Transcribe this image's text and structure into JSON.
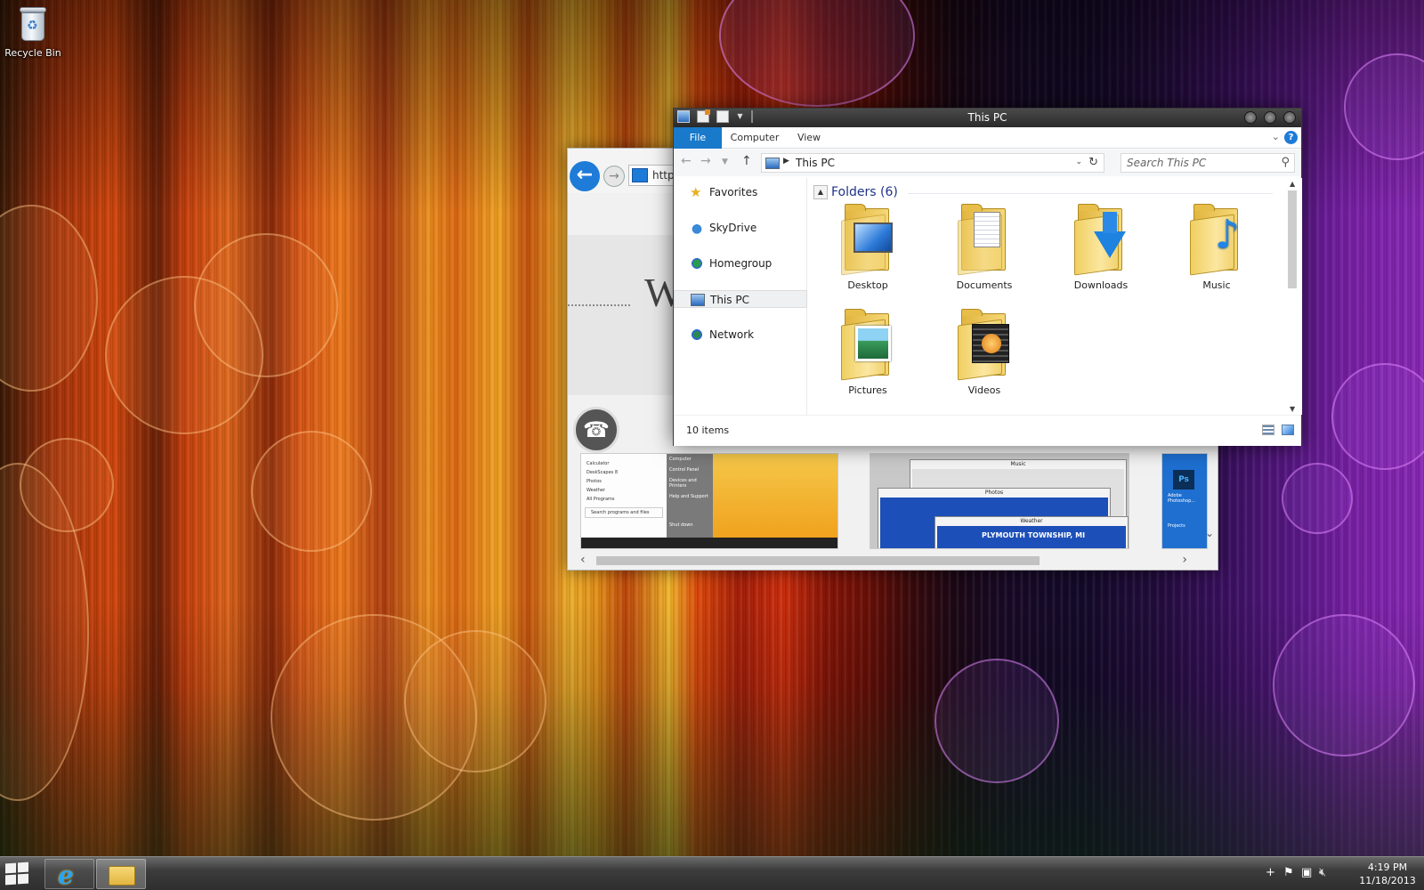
{
  "desktop": {
    "icons": [
      {
        "label": "Recycle Bin",
        "icon": "recycle-bin-icon"
      }
    ]
  },
  "browser": {
    "address": "http:/",
    "heading_char": "W",
    "thumbnails": {
      "start_menu": [
        "Calculator",
        "DeskScapes 8",
        "Photos",
        "Weather",
        "All Programs"
      ],
      "start_side": [
        "Computer",
        "Control Panel",
        "Devices and Printers",
        "Help and Support"
      ],
      "search_placeholder": "Search programs and files",
      "shutdown": "Shut down",
      "windows": [
        "Music",
        "Photos",
        "Weather"
      ],
      "banner": "PLYMOUTH TOWNSHIP, MI",
      "app_tiles": [
        "Adobe Photoshop...",
        "Projects"
      ],
      "ps_glyph": "Ps"
    }
  },
  "explorer": {
    "title": "This PC",
    "ribbon_tabs": [
      "File",
      "Computer",
      "View"
    ],
    "help_glyph": "?",
    "address_path": "This PC",
    "search_placeholder": "Search This PC",
    "nav_items": [
      {
        "label": "Favorites",
        "icon": "star-icon"
      },
      {
        "label": "SkyDrive",
        "icon": "skydrive-icon"
      },
      {
        "label": "Homegroup",
        "icon": "homegroup-icon"
      },
      {
        "label": "This PC",
        "icon": "this-pc-icon",
        "selected": true
      },
      {
        "label": "Network",
        "icon": "network-icon"
      }
    ],
    "group_header": "Folders (6)",
    "folders": [
      {
        "label": "Desktop",
        "icon": "desktop-folder-icon"
      },
      {
        "label": "Documents",
        "icon": "documents-folder-icon"
      },
      {
        "label": "Downloads",
        "icon": "downloads-folder-icon"
      },
      {
        "label": "Music",
        "icon": "music-folder-icon"
      },
      {
        "label": "Pictures",
        "icon": "pictures-folder-icon"
      },
      {
        "label": "Videos",
        "icon": "videos-folder-icon"
      }
    ],
    "status": "10 items"
  },
  "taskbar": {
    "apps": [
      "internet-explorer-icon",
      "file-explorer-icon"
    ],
    "clock": {
      "time": "4:19 PM",
      "date": "11/18/2013"
    }
  },
  "colors": {
    "ribbon_file_tab": "#1979ca",
    "group_header": "#1e3287",
    "ie_blue": "#1e7bd8"
  }
}
